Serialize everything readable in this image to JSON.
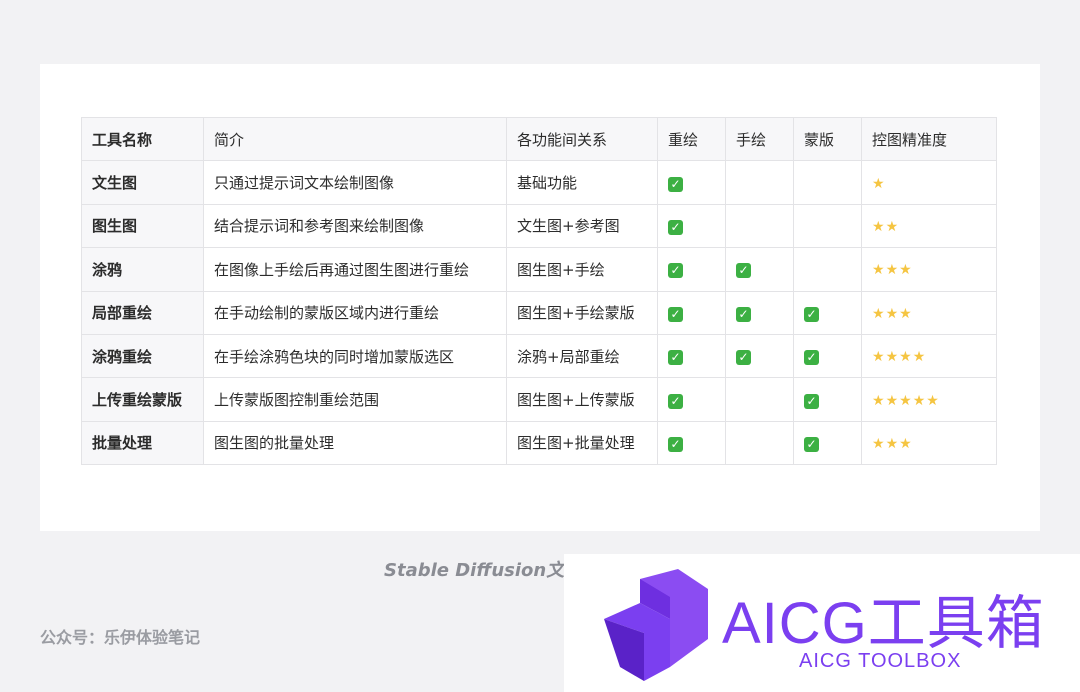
{
  "table": {
    "headers": [
      "工具名称",
      "简介",
      "各功能间关系",
      "重绘",
      "手绘",
      "蒙版",
      "控图精准度"
    ],
    "rows": [
      {
        "name": "文生图",
        "desc": "只通过提示词文本绘制图像",
        "relation": "基础功能",
        "redraw": true,
        "handdraw": false,
        "mask": false,
        "precision": 1
      },
      {
        "name": "图生图",
        "desc": "结合提示词和参考图来绘制图像",
        "relation": "文生图+参考图",
        "redraw": true,
        "handdraw": false,
        "mask": false,
        "precision": 2
      },
      {
        "name": "涂鸦",
        "desc": "在图像上手绘后再通过图生图进行重绘",
        "relation": "图生图+手绘",
        "redraw": true,
        "handdraw": true,
        "mask": false,
        "precision": 3
      },
      {
        "name": "局部重绘",
        "desc": "在手动绘制的蒙版区域内进行重绘",
        "relation": "图生图+手绘蒙版",
        "redraw": true,
        "handdraw": true,
        "mask": true,
        "precision": 3
      },
      {
        "name": "涂鸦重绘",
        "desc": "在手绘涂鸦色块的同时增加蒙版选区",
        "relation": "涂鸦+局部重绘",
        "redraw": true,
        "handdraw": true,
        "mask": true,
        "precision": 4
      },
      {
        "name": "上传重绘蒙版",
        "desc": "上传蒙版图控制重绘范围",
        "relation": "图生图+上传蒙版",
        "redraw": true,
        "handdraw": false,
        "mask": true,
        "precision": 5
      },
      {
        "name": "批量处理",
        "desc": "图生图的批量处理",
        "relation": "图生图+批量处理",
        "redraw": true,
        "handdraw": false,
        "mask": true,
        "precision": 3
      }
    ],
    "check_icon": "check-mark-icon",
    "star_icon": "star-icon"
  },
  "caption": "Stable Diffusion文生图",
  "footer": "公众号：乐伊体验笔记",
  "logo": {
    "title": "AICG工具箱",
    "subtitle": "AICG TOOLBOX",
    "color": "#7b3ff0"
  }
}
